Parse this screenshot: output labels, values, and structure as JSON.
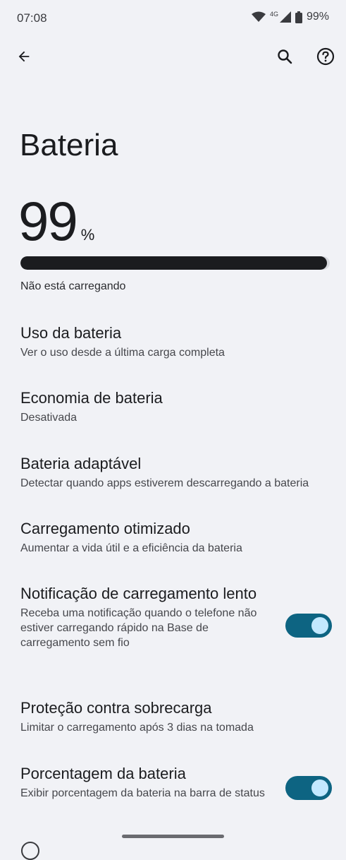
{
  "status_bar": {
    "time": "07:08",
    "network_label": "4G",
    "battery_text": "99%"
  },
  "top_bar": {
    "back_icon": "arrow-back-icon",
    "search_icon": "search-icon",
    "help_icon": "help-icon"
  },
  "page": {
    "title": "Bateria",
    "percent_value": "99",
    "percent_sign": "%",
    "level_fraction": 0.99,
    "charge_status": "Não está carregando"
  },
  "settings": [
    {
      "title": "Uso da bateria",
      "subtitle": "Ver o uso desde a última carga completa"
    },
    {
      "title": "Economia de bateria",
      "subtitle": "Desativada"
    },
    {
      "title": "Bateria adaptável",
      "subtitle": "Detectar quando apps estiverem descarregando a bateria"
    },
    {
      "title": "Carregamento otimizado",
      "subtitle": "Aumentar a vida útil e a eficiência da bateria"
    },
    {
      "title": "Notificação de carregamento lento",
      "subtitle": "Receba uma notificação quando o telefone não estiver carregando rápido na Base de carregamento sem fio",
      "toggle": true
    },
    {
      "title": "Proteção contra sobrecarga",
      "subtitle": "Limitar o carregamento após 3 dias na tomada"
    },
    {
      "title": "Porcentagem da bateria",
      "subtitle": "Exibir porcentagem da bateria na barra de status",
      "toggle": true
    }
  ],
  "colors": {
    "background": "#f1f2f6",
    "toggle_track": "#0d6482",
    "toggle_thumb": "#c2e8ff",
    "level_fill": "#1b1c1f"
  }
}
